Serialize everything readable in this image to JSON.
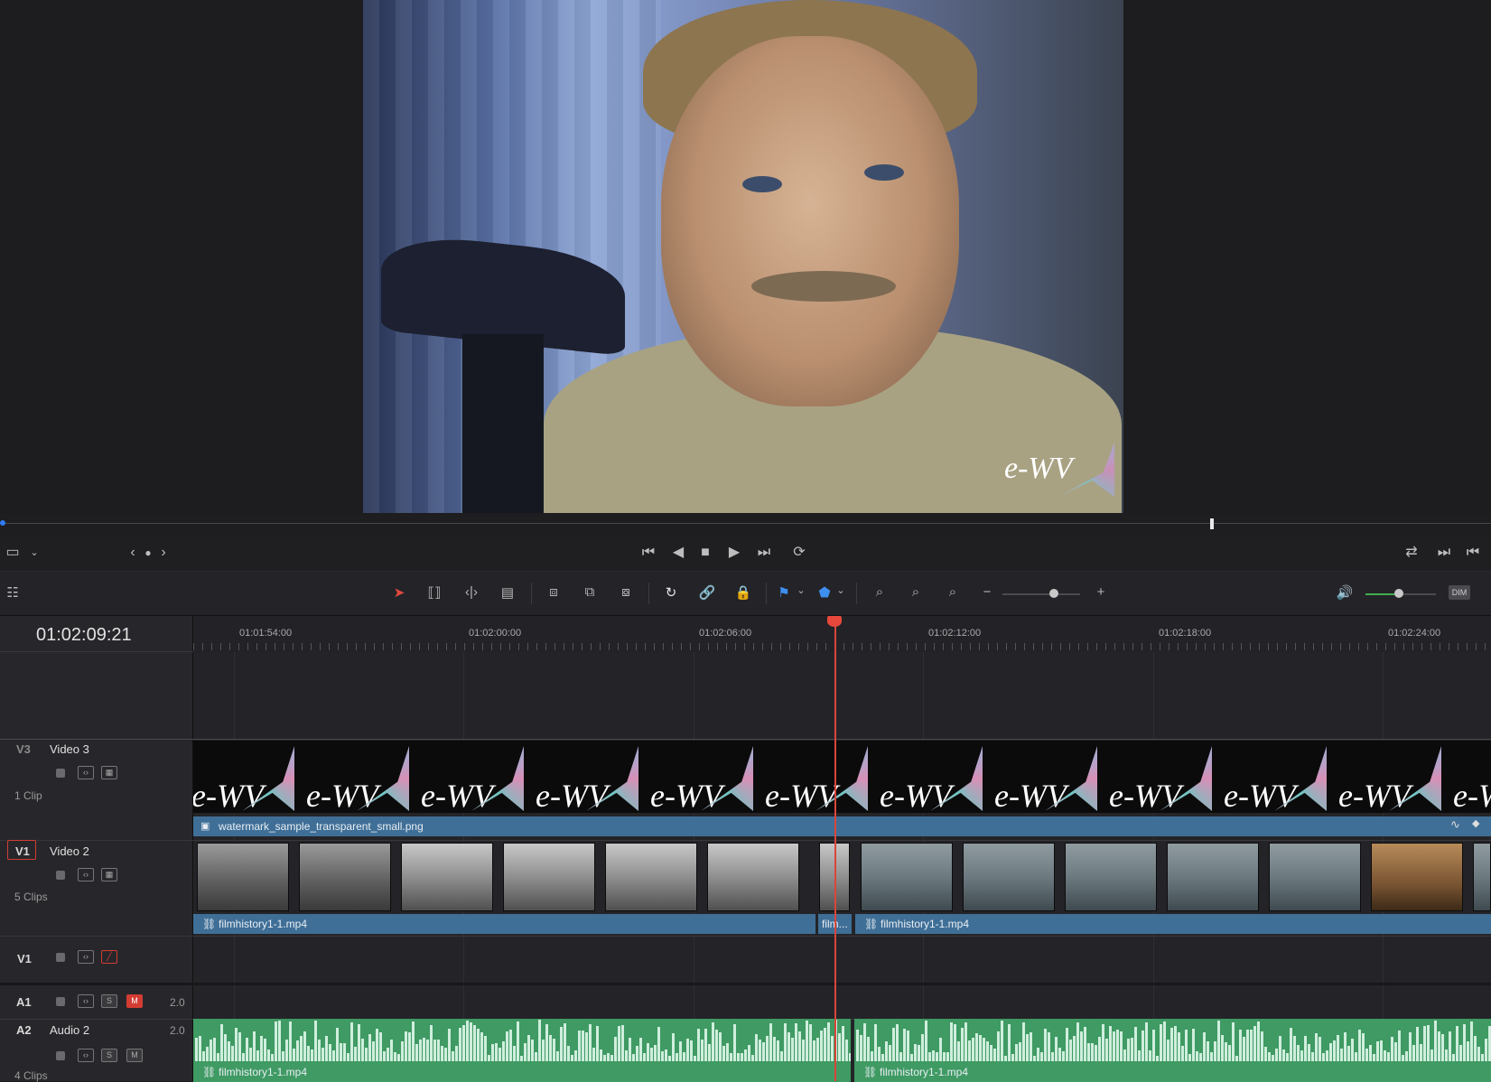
{
  "viewer": {
    "watermark_text": "e-WV",
    "nav_dot_label": "●"
  },
  "transport": {
    "icons": [
      "viewer-mode-icon",
      "chevron-down-icon",
      "prev-icon",
      "dot-icon",
      "next-icon",
      "skip-start-icon",
      "play-reverse-icon",
      "stop-icon",
      "play-icon",
      "skip-end-icon",
      "loop-icon",
      "match-frame-icon",
      "next-clip-icon",
      "prev-clip-icon"
    ]
  },
  "toolbar": {
    "dim_label": "DIM"
  },
  "timeline": {
    "timecode": "01:02:09:21",
    "ruler_labels": [
      "01:01:54:00",
      "01:02:00:00",
      "01:02:06:00",
      "01:02:12:00",
      "01:02:18:00",
      "01:02:24:00"
    ],
    "tracks": {
      "v3": {
        "id": "V3",
        "name": "Video 3",
        "clips": "1 Clip"
      },
      "v2": {
        "id": "V1",
        "name": "Video 2",
        "clips": "5 Clips"
      },
      "v1": {
        "id": "V1"
      },
      "a1": {
        "id": "A1",
        "level": "2.0",
        "solo": "S",
        "mute": "M"
      },
      "a2": {
        "id": "A2",
        "name": "Audio 2",
        "level": "2.0",
        "solo": "S",
        "mute": "M",
        "clips": "4 Clips"
      }
    },
    "clips": {
      "v3_clip": "watermark_sample_transparent_small.png",
      "v2_clip1": "filmhistory1-1.mp4",
      "v2_clip2": "film...",
      "v2_clip3": "filmhistory1-1.mp4",
      "a2_clip1": "filmhistory1-1.mp4",
      "a2_clip2": "filmhistory1-1.mp4"
    }
  },
  "colors": {
    "accent_blue": "#2e7cf6",
    "clip_blue": "#3f6f97",
    "audio_green": "#3f9a63",
    "playhead_red": "#d8463c",
    "mute_red": "#d33c33"
  }
}
